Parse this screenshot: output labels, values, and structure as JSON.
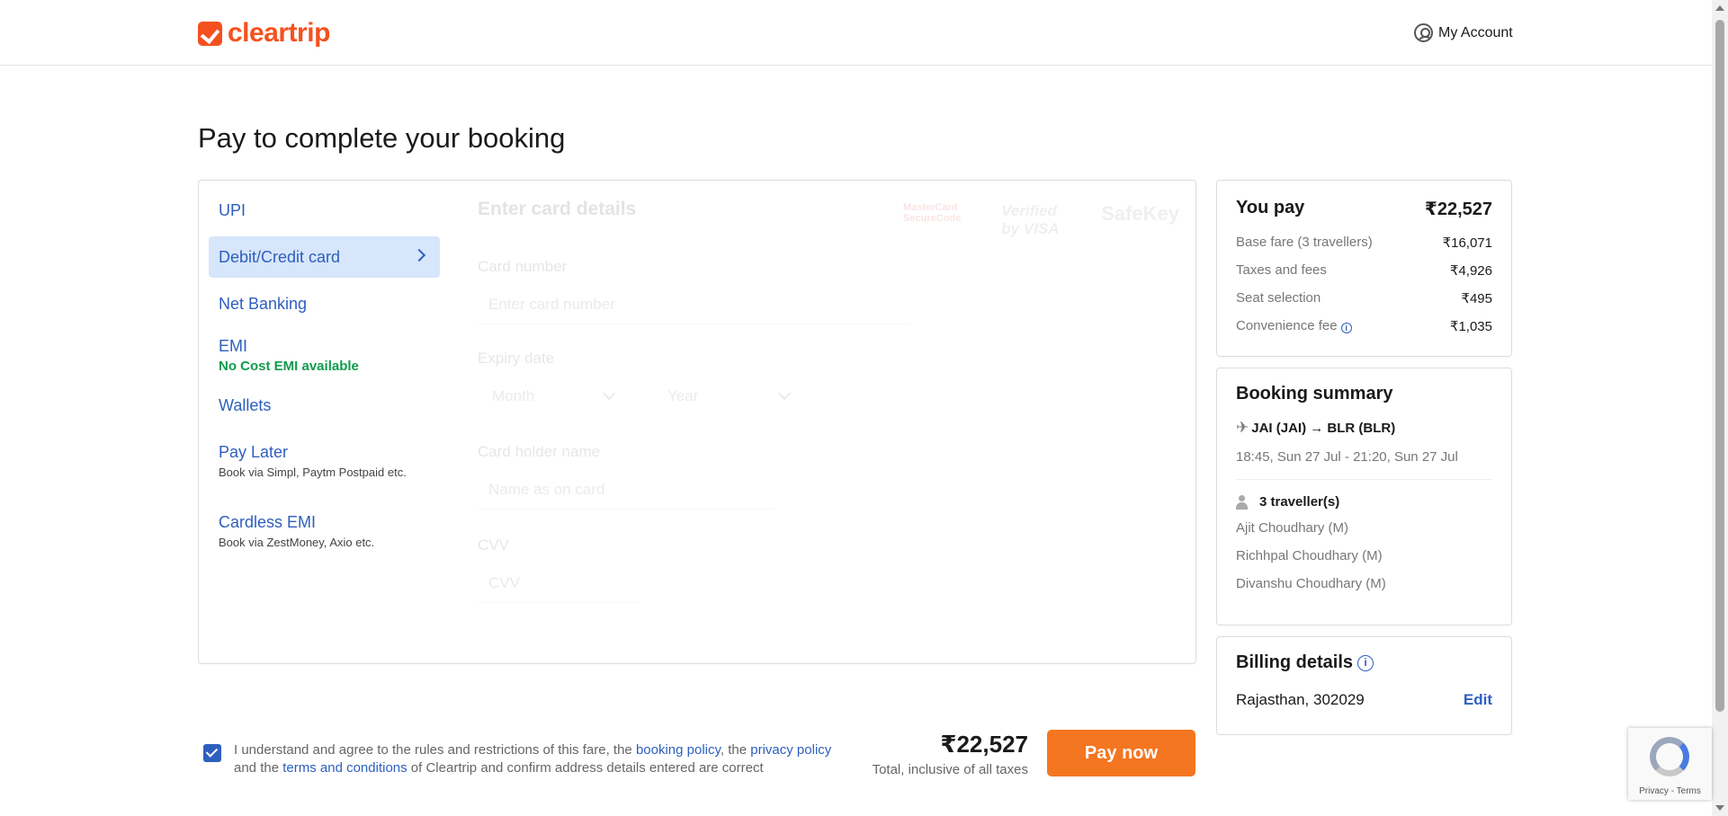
{
  "header": {
    "logo_text": "cleartrip",
    "account_label": "My Account"
  },
  "page_title": "Pay to complete your booking",
  "payment_methods": [
    {
      "label": "UPI",
      "sub": ""
    },
    {
      "label": "Debit/Credit card",
      "sub": ""
    },
    {
      "label": "Net Banking",
      "sub": ""
    },
    {
      "label": "EMI",
      "sub": "No Cost EMI available"
    },
    {
      "label": "Wallets",
      "sub": ""
    },
    {
      "label": "Pay Later",
      "sub": "Book via Simpl, Paytm Postpaid etc."
    },
    {
      "label": "Cardless EMI",
      "sub": "Book via ZestMoney, Axio etc."
    }
  ],
  "card_form": {
    "title": "Enter card details",
    "logos": [
      "MasterCard SecureCode",
      "Verified by VISA",
      "SafeKey"
    ],
    "card_number_label": "Card number",
    "card_number_placeholder": "Enter card number",
    "expiry_label": "Expiry date",
    "month_placeholder": "Month",
    "year_placeholder": "Year",
    "holder_label": "Card holder name",
    "holder_placeholder": "Name as on card",
    "cvv_label": "CVV",
    "cvv_placeholder": "CVV"
  },
  "agreement": {
    "text_1": "I understand and agree to the rules and restrictions of this fare, the ",
    "link_booking_policy": "booking policy",
    "text_2": ", the ",
    "link_privacy_policy": "privacy policy",
    "text_3": " and the ",
    "link_terms": "terms and conditions",
    "text_4": " of Cleartrip and confirm address details entered are correct",
    "checked": true
  },
  "total": {
    "amount": "₹22,527",
    "note": "Total, inclusive of all taxes"
  },
  "pay_button": "Pay now",
  "you_pay": {
    "title": "You pay",
    "amount": "₹22,527",
    "rows": [
      {
        "label": "Base fare (3 travellers)",
        "amount": "₹16,071"
      },
      {
        "label": "Taxes and fees",
        "amount": "₹4,926"
      },
      {
        "label": "Seat selection",
        "amount": "₹495"
      },
      {
        "label": "Convenience fee",
        "amount": "₹1,035"
      }
    ]
  },
  "booking_summary": {
    "title": "Booking summary",
    "route": "JAI (JAI) → BLR (BLR)",
    "timing": "18:45, Sun 27 Jul - 21:20, Sun 27 Jul",
    "travellers_label": "3 traveller(s)",
    "travellers": [
      "Ajit Choudhary (M)",
      "Richhpal Choudhary (M)",
      "Divanshu Choudhary (M)"
    ]
  },
  "billing": {
    "title": "Billing details",
    "address": "Rajasthan, 302029",
    "edit_label": "Edit"
  },
  "recaptcha": {
    "text": "Privacy - Terms"
  },
  "colors": {
    "brand": "#f4511e",
    "link": "#2d5fbf",
    "pay_button": "#f47621",
    "emi_green": "#119b4d",
    "active_method_bg": "#d7e6fb"
  }
}
